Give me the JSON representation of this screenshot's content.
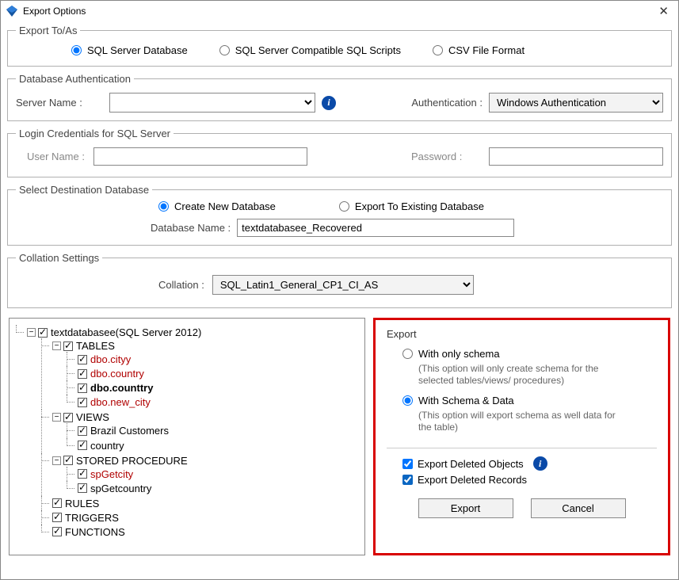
{
  "window": {
    "title": "Export Options"
  },
  "exportToAs": {
    "legend": "Export To/As",
    "opt_sql_db": "SQL Server Database",
    "opt_sql_scripts": "SQL Server Compatible SQL Scripts",
    "opt_csv": "CSV File Format",
    "selected": "sql_db"
  },
  "dbAuth": {
    "legend": "Database Authentication",
    "server_label": "Server Name :",
    "server_value": "",
    "auth_label": "Authentication :",
    "auth_value": "Windows Authentication"
  },
  "login": {
    "legend": "Login Credentials for SQL Server",
    "user_label": "User Name :",
    "user_value": "",
    "pass_label": "Password :",
    "pass_value": ""
  },
  "dest": {
    "legend": "Select Destination Database",
    "opt_create": "Create New Database",
    "opt_existing": "Export To Existing Database",
    "selected": "create",
    "dbname_label": "Database Name :",
    "dbname_value": "textdatabasee_Recovered"
  },
  "collation": {
    "legend": "Collation Settings",
    "label": "Collation :",
    "value": "SQL_Latin1_General_CP1_CI_AS"
  },
  "tree": {
    "root": "textdatabasee(SQL Server 2012)",
    "tables_label": "TABLES",
    "tables": [
      "dbo.cityy",
      "dbo.country",
      "dbo.counttry",
      "dbo.new_city"
    ],
    "views_label": "VIEWS",
    "views": [
      "Brazil Customers",
      "country"
    ],
    "sp_label": "STORED PROCEDURE",
    "sps": [
      "spGetcity",
      "spGetcountry"
    ],
    "rules_label": "RULES",
    "triggers_label": "TRIGGERS",
    "functions_label": "FUNCTIONS"
  },
  "export": {
    "legend": "Export",
    "opt_schema": "With only schema",
    "schema_note": "(This option will only create schema for the  selected tables/views/ procedures)",
    "opt_schema_data": "With Schema & Data",
    "schema_data_note": "(This option will export schema as well data for the table)",
    "selected": "schema_data",
    "chk_del_obj": "Export Deleted Objects",
    "chk_del_rec": "Export Deleted Records",
    "btn_export": "Export",
    "btn_cancel": "Cancel"
  }
}
